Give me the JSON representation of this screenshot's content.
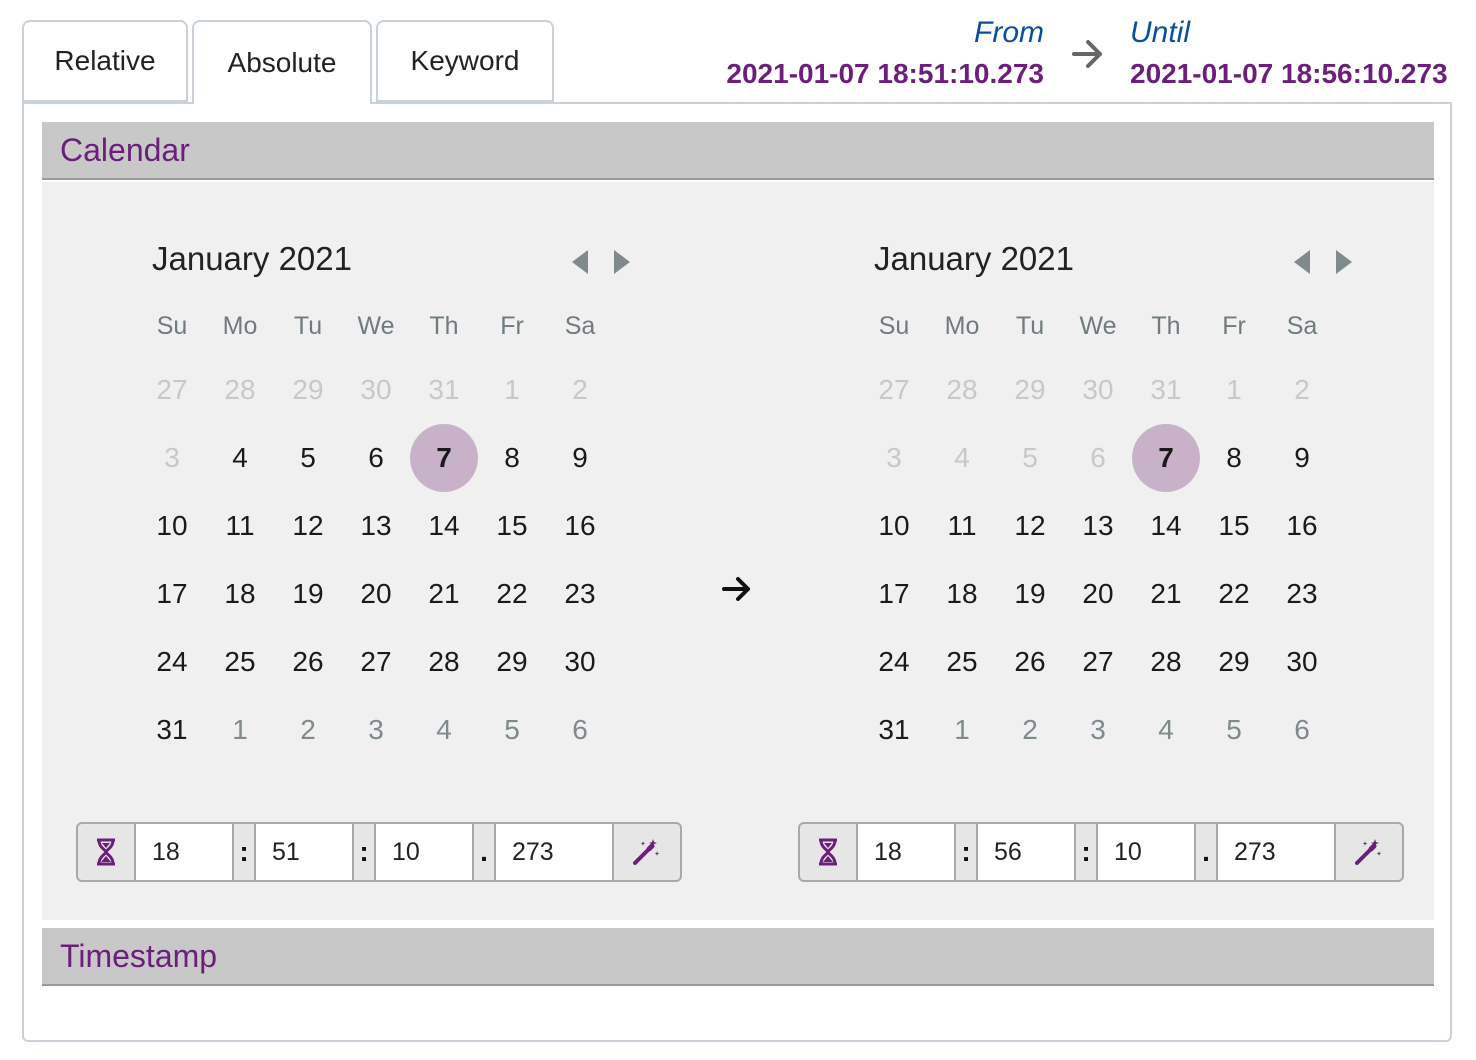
{
  "tabs": [
    {
      "label": "Relative",
      "active": false
    },
    {
      "label": "Absolute",
      "active": true
    },
    {
      "label": "Keyword",
      "active": false
    }
  ],
  "range": {
    "from_label": "From",
    "from_value": "2021-01-07 18:51:10.273",
    "until_label": "Until",
    "until_value": "2021-01-07 18:56:10.273"
  },
  "sections": {
    "calendar": "Calendar",
    "timestamp": "Timestamp"
  },
  "weekdays": [
    "Su",
    "Mo",
    "Tu",
    "We",
    "Th",
    "Fr",
    "Sa"
  ],
  "from_calendar": {
    "title": "January 2021",
    "weeks": [
      [
        "27",
        "28",
        "29",
        "30",
        "31",
        "1",
        "2"
      ],
      [
        "3",
        "4",
        "5",
        "6",
        "7",
        "8",
        "9"
      ],
      [
        "10",
        "11",
        "12",
        "13",
        "14",
        "15",
        "16"
      ],
      [
        "17",
        "18",
        "19",
        "20",
        "21",
        "22",
        "23"
      ],
      [
        "24",
        "25",
        "26",
        "27",
        "28",
        "29",
        "30"
      ],
      [
        "31",
        "1",
        "2",
        "3",
        "4",
        "5",
        "6"
      ]
    ],
    "states": [
      [
        "muted",
        "muted",
        "muted",
        "muted",
        "muted",
        "muted",
        "muted"
      ],
      [
        "muted",
        "normal",
        "normal",
        "normal",
        "selected",
        "normal",
        "normal"
      ],
      [
        "normal",
        "normal",
        "normal",
        "normal",
        "normal",
        "normal",
        "normal"
      ],
      [
        "normal",
        "normal",
        "normal",
        "normal",
        "normal",
        "normal",
        "normal"
      ],
      [
        "normal",
        "normal",
        "normal",
        "normal",
        "normal",
        "normal",
        "normal"
      ],
      [
        "normal",
        "dim",
        "dim",
        "dim",
        "dim",
        "dim",
        "dim"
      ]
    ],
    "time": {
      "hours": "18",
      "minutes": "51",
      "seconds": "10",
      "millis": "273"
    }
  },
  "until_calendar": {
    "title": "January 2021",
    "weeks": [
      [
        "27",
        "28",
        "29",
        "30",
        "31",
        "1",
        "2"
      ],
      [
        "3",
        "4",
        "5",
        "6",
        "7",
        "8",
        "9"
      ],
      [
        "10",
        "11",
        "12",
        "13",
        "14",
        "15",
        "16"
      ],
      [
        "17",
        "18",
        "19",
        "20",
        "21",
        "22",
        "23"
      ],
      [
        "24",
        "25",
        "26",
        "27",
        "28",
        "29",
        "30"
      ],
      [
        "31",
        "1",
        "2",
        "3",
        "4",
        "5",
        "6"
      ]
    ],
    "states": [
      [
        "muted",
        "muted",
        "muted",
        "muted",
        "muted",
        "muted",
        "muted"
      ],
      [
        "muted",
        "muted",
        "muted",
        "muted",
        "selected",
        "normal",
        "normal"
      ],
      [
        "normal",
        "normal",
        "normal",
        "normal",
        "normal",
        "normal",
        "normal"
      ],
      [
        "normal",
        "normal",
        "normal",
        "normal",
        "normal",
        "normal",
        "normal"
      ],
      [
        "normal",
        "normal",
        "normal",
        "normal",
        "normal",
        "normal",
        "normal"
      ],
      [
        "normal",
        "dim",
        "dim",
        "dim",
        "dim",
        "dim",
        "dim"
      ]
    ],
    "time": {
      "hours": "18",
      "minutes": "56",
      "seconds": "10",
      "millis": "273"
    }
  },
  "separators": {
    "hm": ":",
    "ms": ":",
    "sm": "."
  },
  "icons": {
    "nav_prev": "triangle-left-icon",
    "nav_next": "triangle-right-icon",
    "hourglass": "hourglass-icon",
    "wand": "magic-wand-icon",
    "arrow": "arrow-right-icon"
  },
  "colors": {
    "accent_purple": "#6b1f7b",
    "link_blue": "#0a4f9c",
    "selected_day": "#c8b2c9",
    "section_header": "#c8c8c8",
    "calendar_bg": "#f0f0f0"
  }
}
